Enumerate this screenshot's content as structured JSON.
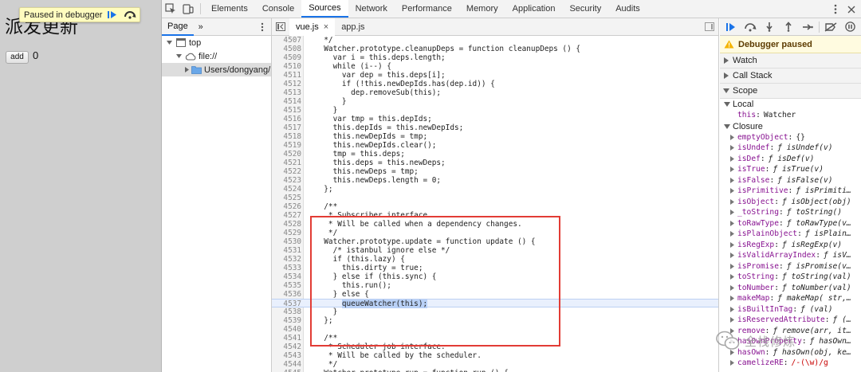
{
  "page": {
    "heading": "派发更新",
    "add_button": "add",
    "count": "0",
    "paused_overlay": {
      "text": "Paused in debugger",
      "resume_icon": "resume-icon",
      "step_over_icon": "step-over-icon"
    }
  },
  "devtools": {
    "tabs": [
      "Elements",
      "Console",
      "Sources",
      "Network",
      "Performance",
      "Memory",
      "Application",
      "Security",
      "Audits"
    ],
    "active_tab": "Sources",
    "navigator": {
      "tab": "Page",
      "more": "»",
      "tree": [
        {
          "label": "top",
          "level": 0,
          "icon": "frame-icon",
          "expanded": true
        },
        {
          "label": "file://",
          "level": 1,
          "icon": "cloud-icon",
          "expanded": true
        },
        {
          "label": "Users/dongyang/D",
          "level": 2,
          "icon": "folder-icon",
          "expanded": false,
          "selected": true
        }
      ]
    },
    "editor": {
      "tabs": [
        {
          "label": "vue.js",
          "closable": true
        },
        {
          "label": "app.js",
          "closable": false
        }
      ],
      "active_tab": "vue.js",
      "current_line": 4537,
      "highlight": "queueWatcher(this);",
      "lines": [
        {
          "n": 4507,
          "t": "  */"
        },
        {
          "n": 4508,
          "t": "  Watcher.prototype.cleanupDeps = function cleanupDeps () {"
        },
        {
          "n": 4509,
          "t": "    var i = this.deps.length;"
        },
        {
          "n": 4510,
          "t": "    while (i--) {"
        },
        {
          "n": 4511,
          "t": "      var dep = this.deps[i];"
        },
        {
          "n": 4512,
          "t": "      if (!this.newDepIds.has(dep.id)) {"
        },
        {
          "n": 4513,
          "t": "        dep.removeSub(this);"
        },
        {
          "n": 4514,
          "t": "      }"
        },
        {
          "n": 4515,
          "t": "    }"
        },
        {
          "n": 4516,
          "t": "    var tmp = this.depIds;"
        },
        {
          "n": 4517,
          "t": "    this.depIds = this.newDepIds;"
        },
        {
          "n": 4518,
          "t": "    this.newDepIds = tmp;"
        },
        {
          "n": 4519,
          "t": "    this.newDepIds.clear();"
        },
        {
          "n": 4520,
          "t": "    tmp = this.deps;"
        },
        {
          "n": 4521,
          "t": "    this.deps = this.newDeps;"
        },
        {
          "n": 4522,
          "t": "    this.newDeps = tmp;"
        },
        {
          "n": 4523,
          "t": "    this.newDeps.length = 0;"
        },
        {
          "n": 4524,
          "t": "  };"
        },
        {
          "n": 4525,
          "t": ""
        },
        {
          "n": 4526,
          "t": "  /**"
        },
        {
          "n": 4527,
          "t": "   * Subscriber interface."
        },
        {
          "n": 4528,
          "t": "   * Will be called when a dependency changes."
        },
        {
          "n": 4529,
          "t": "   */"
        },
        {
          "n": 4530,
          "t": "  Watcher.prototype.update = function update () {"
        },
        {
          "n": 4531,
          "t": "    /* istanbul ignore else */"
        },
        {
          "n": 4532,
          "t": "    if (this.lazy) {"
        },
        {
          "n": 4533,
          "t": "      this.dirty = true;"
        },
        {
          "n": 4534,
          "t": "    } else if (this.sync) {"
        },
        {
          "n": 4535,
          "t": "      this.run();"
        },
        {
          "n": 4536,
          "t": "    } else {"
        },
        {
          "n": 4537,
          "t": "      queueWatcher(this);"
        },
        {
          "n": 4538,
          "t": "    }"
        },
        {
          "n": 4539,
          "t": "  };"
        },
        {
          "n": 4540,
          "t": ""
        },
        {
          "n": 4541,
          "t": "  /**"
        },
        {
          "n": 4542,
          "t": "   * Scheduler job interface."
        },
        {
          "n": 4543,
          "t": "   * Will be called by the scheduler."
        },
        {
          "n": 4544,
          "t": "   */"
        },
        {
          "n": 4545,
          "t": "  Watcher.prototype.run = function run () {"
        }
      ]
    },
    "debugger": {
      "banner": "Debugger paused",
      "sections": [
        "Watch",
        "Call Stack",
        "Scope"
      ],
      "local_label": "Local",
      "local": [
        {
          "name": "this",
          "value": "Watcher",
          "kind": "obj",
          "arrow": false
        }
      ],
      "closure_label": "Closure",
      "closure": [
        {
          "name": "emptyObject",
          "value": "{}",
          "kind": "obj",
          "arrow": true
        },
        {
          "name": "isUndef",
          "value": "ƒ isUndef(v)",
          "kind": "fn",
          "arrow": true
        },
        {
          "name": "isDef",
          "value": "ƒ isDef(v)",
          "kind": "fn",
          "arrow": true
        },
        {
          "name": "isTrue",
          "value": "ƒ isTrue(v)",
          "kind": "fn",
          "arrow": true
        },
        {
          "name": "isFalse",
          "value": "ƒ isFalse(v)",
          "kind": "fn",
          "arrow": true
        },
        {
          "name": "isPrimitive",
          "value": "ƒ isPrimiti…",
          "kind": "fn",
          "arrow": true
        },
        {
          "name": "isObject",
          "value": "ƒ isObject(obj)",
          "kind": "fn",
          "arrow": true
        },
        {
          "name": "_toString",
          "value": "ƒ toString()",
          "kind": "fn",
          "arrow": true
        },
        {
          "name": "toRawType",
          "value": "ƒ toRawType(v…",
          "kind": "fn",
          "arrow": true
        },
        {
          "name": "isPlainObject",
          "value": "ƒ isPlain…",
          "kind": "fn",
          "arrow": true
        },
        {
          "name": "isRegExp",
          "value": "ƒ isRegExp(v)",
          "kind": "fn",
          "arrow": true
        },
        {
          "name": "isValidArrayIndex",
          "value": "ƒ isV…",
          "kind": "fn",
          "arrow": true
        },
        {
          "name": "isPromise",
          "value": "ƒ isPromise(v…",
          "kind": "fn",
          "arrow": true
        },
        {
          "name": "toString",
          "value": "ƒ toString(val)",
          "kind": "fn",
          "arrow": true
        },
        {
          "name": "toNumber",
          "value": "ƒ toNumber(val)",
          "kind": "fn",
          "arrow": true
        },
        {
          "name": "makeMap",
          "value": "ƒ makeMap( str,…",
          "kind": "fn",
          "arrow": true
        },
        {
          "name": "isBuiltInTag",
          "value": "ƒ (val)",
          "kind": "fn",
          "arrow": true
        },
        {
          "name": "isReservedAttribute",
          "value": "ƒ (…",
          "kind": "fn",
          "arrow": true
        },
        {
          "name": "remove",
          "value": "ƒ remove(arr, it…",
          "kind": "fn",
          "arrow": true
        },
        {
          "name": "hasOwnProperty",
          "value": "ƒ hasOwn…",
          "kind": "fn",
          "arrow": true
        },
        {
          "name": "hasOwn",
          "value": "ƒ hasOwn(obj, ke…",
          "kind": "fn",
          "arrow": true
        },
        {
          "name": "camelizeRE",
          "value": "/-(\\w)/g",
          "kind": "re",
          "arrow": true
        }
      ]
    },
    "watermark": "全栈修炼"
  },
  "colors": {
    "active_tab_underline": "#1a73e8",
    "debugger_blue": "#1a73e8",
    "paused_banner_bg": "#fffbe0",
    "highlight_box": "#e23c35",
    "property_name": "#881391"
  }
}
